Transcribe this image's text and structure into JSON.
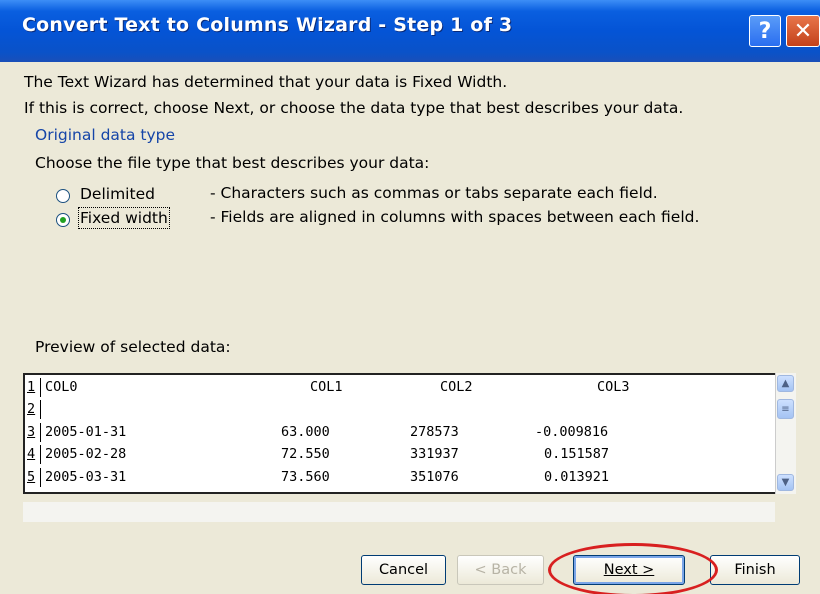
{
  "window": {
    "title": "Convert Text to Columns Wizard - Step 1 of 3",
    "help_glyph": "?",
    "close_glyph": "✕"
  },
  "intro": {
    "line1": "The Text Wizard has determined that your data is Fixed Width.",
    "line2": "If this is correct, choose Next, or choose the data type that best describes your data."
  },
  "original_data_type": {
    "group_label": "Original data type",
    "prompt": "Choose the file type that best describes your data:",
    "options": [
      {
        "label": "Delimited",
        "description": "- Characters such as commas or tabs separate each field.",
        "selected": false
      },
      {
        "label": "Fixed width",
        "description": "- Fields are aligned in columns with spaces between each field.",
        "selected": true
      }
    ]
  },
  "preview": {
    "label": "Preview of selected data:",
    "rows": [
      {
        "num": "1",
        "cells": [
          "COL0",
          "COL1",
          "COL2",
          "COL3"
        ]
      },
      {
        "num": "2",
        "cells": [
          "",
          "",
          "",
          ""
        ]
      },
      {
        "num": "3",
        "cells": [
          "2005-01-31",
          "63.000",
          "278573",
          "-0.009816"
        ]
      },
      {
        "num": "4",
        "cells": [
          "2005-02-28",
          "72.550",
          "331937",
          "0.151587"
        ]
      },
      {
        "num": "5",
        "cells": [
          "2005-03-31",
          "73.560",
          "351076",
          "0.013921"
        ]
      }
    ]
  },
  "buttons": {
    "cancel": "Cancel",
    "back": "< Back",
    "next": "Next >",
    "finish": "Finish"
  },
  "colors": {
    "title_bar": "#0454d6",
    "dialog_bg": "#ece9d8",
    "group_label": "#1545a8",
    "highlight_circle": "#d82020"
  }
}
